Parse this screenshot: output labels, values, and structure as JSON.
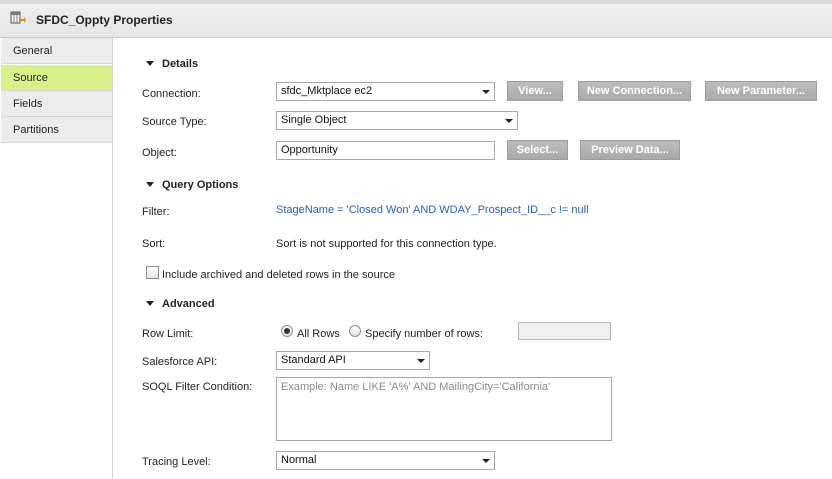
{
  "window": {
    "title": "SFDC_Oppty Properties"
  },
  "sidebar": {
    "items": [
      {
        "label": "General"
      },
      {
        "label": "Source",
        "active": true
      },
      {
        "label": "Fields"
      },
      {
        "label": "Partitions"
      }
    ]
  },
  "details": {
    "section_label": "Details",
    "connection": {
      "label": "Connection:",
      "value": "sfdc_Mktplace ec2"
    },
    "buttons": {
      "view": "View...",
      "new_connection": "New Connection...",
      "new_parameter": "New Parameter..."
    },
    "source_type": {
      "label": "Source Type:",
      "value": "Single Object"
    },
    "object": {
      "label": "Object:",
      "value": "Opportunity",
      "select_button": "Select...",
      "preview_button": "Preview Data..."
    }
  },
  "query_options": {
    "section_label": "Query Options",
    "filter": {
      "label": "Filter:",
      "value": "StageName = 'Closed Won' AND WDAY_Prospect_ID__c != null"
    },
    "sort": {
      "label": "Sort:",
      "value": "Sort is not supported for this connection type."
    },
    "include_archived": {
      "label": "Include archived and deleted rows in the source",
      "checked": false
    }
  },
  "advanced": {
    "section_label": "Advanced",
    "row_limit": {
      "label": "Row Limit:",
      "option_all": "All Rows",
      "option_specify": "Specify number of rows:",
      "selected": "All Rows",
      "count_value": ""
    },
    "salesforce_api": {
      "label": "Salesforce API:",
      "value": "Standard API"
    },
    "soql_filter": {
      "label": "SOQL Filter Condition:",
      "placeholder": "Example: Name LIKE 'A%' AND MailingCity='California'"
    },
    "tracing_level": {
      "label": "Tracing Level:",
      "value": "Normal"
    }
  },
  "icons": {
    "title_icon": "source-properties-icon"
  },
  "colors": {
    "active_tab": "#d8f08a",
    "button_bg": "#b3b3b3",
    "link_text": "#2a5db0"
  }
}
